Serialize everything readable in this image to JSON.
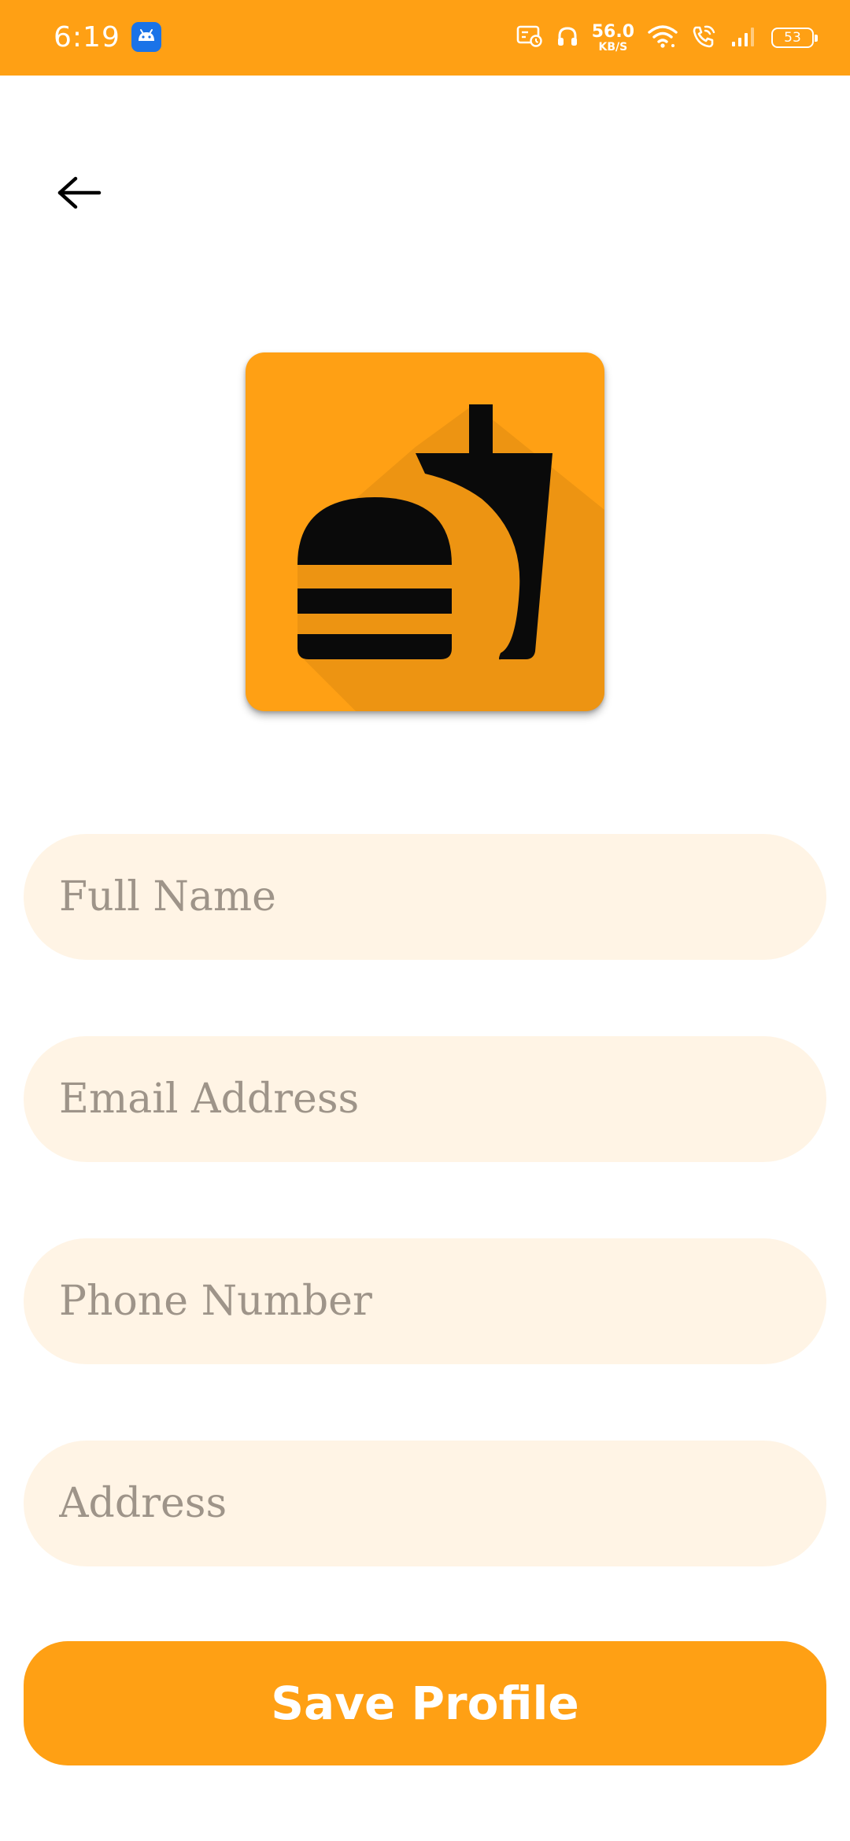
{
  "status_bar": {
    "time": "6:19",
    "network_speed_value": "56.0",
    "network_speed_unit": "KB/S",
    "battery_level": "53",
    "icons": [
      "android-notification-icon",
      "cast-icon",
      "headphones-icon",
      "wifi-icon",
      "wifi-calling-icon",
      "signal-icon",
      "battery-icon"
    ]
  },
  "header": {
    "back_icon": "arrow-left-icon"
  },
  "logo": {
    "icon": "burger-and-drink-icon",
    "background_color": "#FFA014"
  },
  "form": {
    "full_name": {
      "placeholder": "Full Name",
      "value": ""
    },
    "email": {
      "placeholder": "Email Address",
      "value": ""
    },
    "phone": {
      "placeholder": "Phone Number",
      "value": ""
    },
    "address": {
      "placeholder": "Address",
      "value": ""
    }
  },
  "save_button": {
    "label": "Save Profile"
  },
  "colors": {
    "accent": "#FFA014",
    "field_background": "#FFF4E5",
    "placeholder_text": "#9E9489"
  }
}
